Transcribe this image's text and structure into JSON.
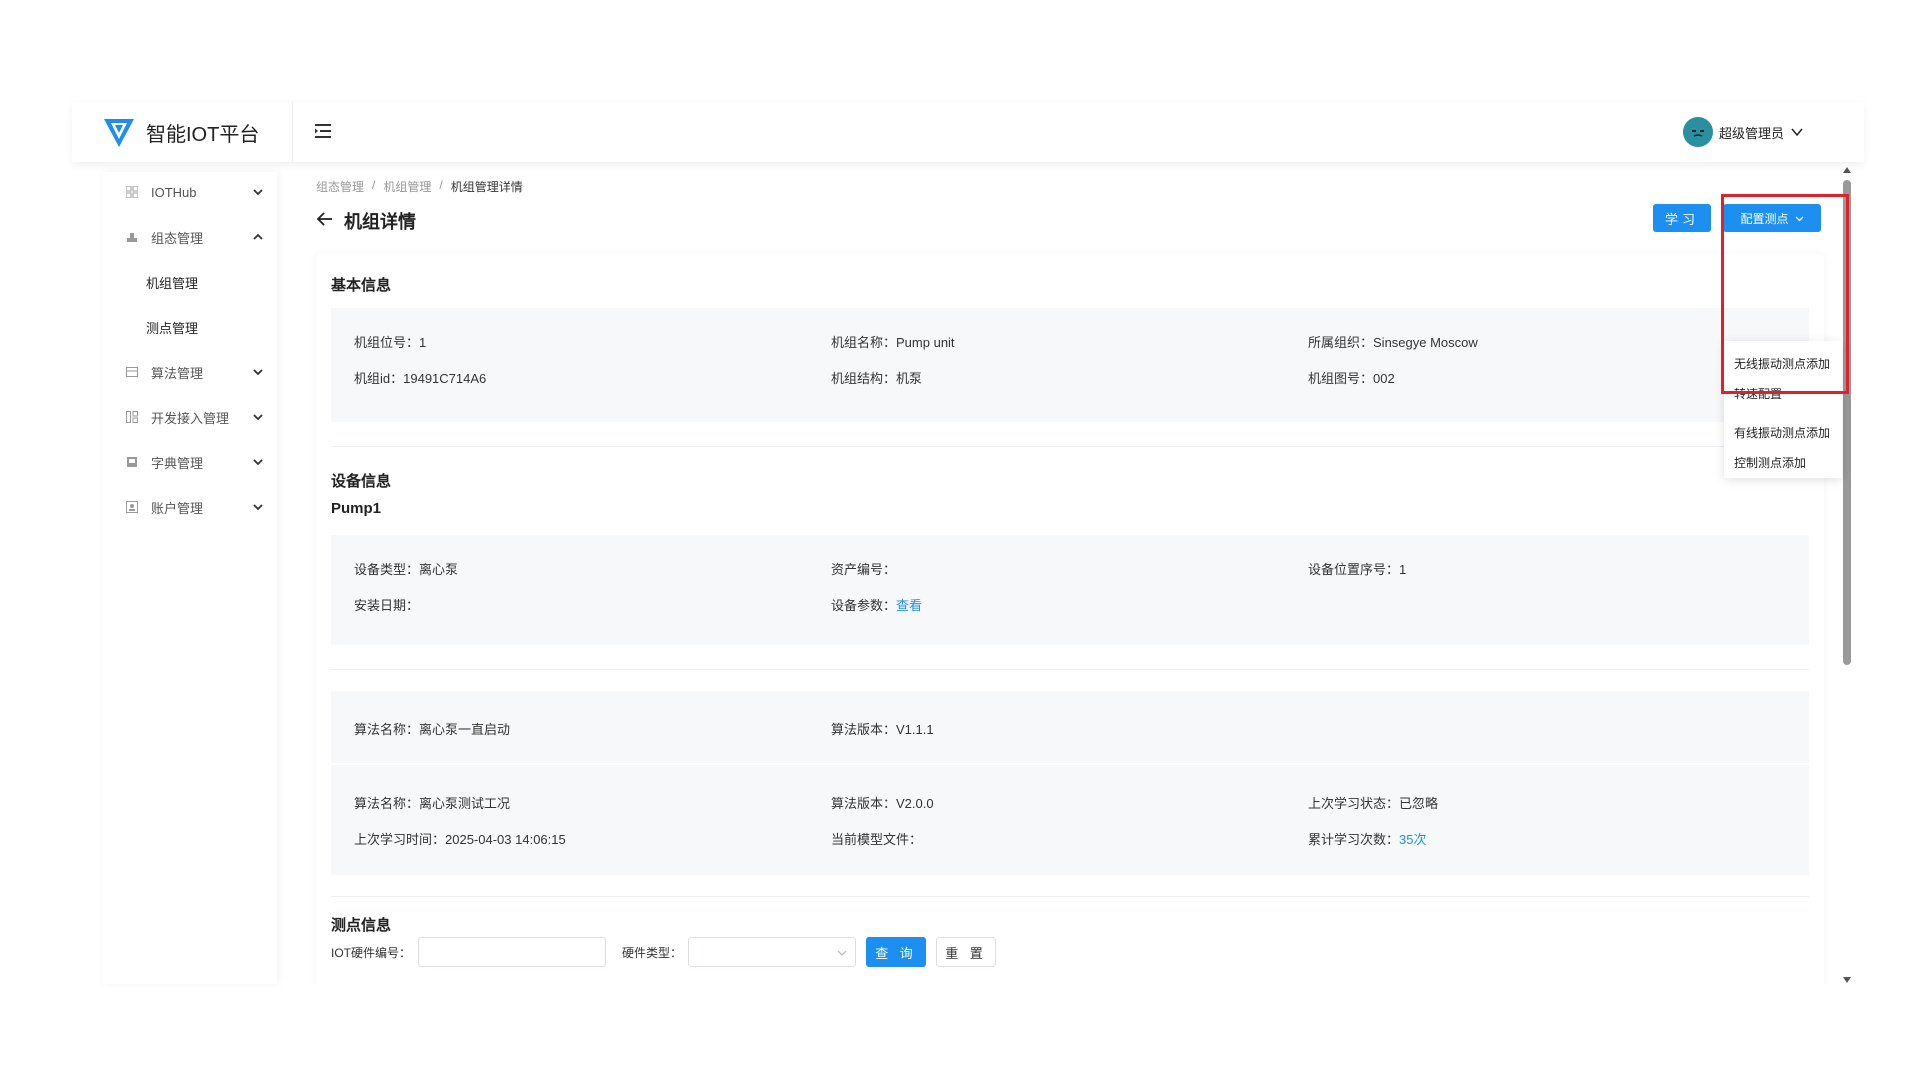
{
  "app": {
    "title": "智能IOT平台"
  },
  "header": {
    "user_name": "超级管理员"
  },
  "sidebar": {
    "items": [
      {
        "label": "IOTHub",
        "icon": "grid-icon",
        "expanded": false
      },
      {
        "label": "组态管理",
        "icon": "chart-icon",
        "expanded": true
      },
      {
        "label": "算法管理",
        "icon": "table-icon",
        "expanded": false
      },
      {
        "label": "开发接入管理",
        "icon": "dev-icon",
        "expanded": false
      },
      {
        "label": "字典管理",
        "icon": "dict-icon",
        "expanded": false
      },
      {
        "label": "账户管理",
        "icon": "account-icon",
        "expanded": false
      }
    ],
    "sub_items": [
      {
        "label": "机组管理"
      },
      {
        "label": "测点管理"
      }
    ]
  },
  "breadcrumb": [
    "组态管理",
    "机组管理",
    "机组管理详情"
  ],
  "page": {
    "title": "机组详情",
    "learn_button": "学习",
    "config_button": "配置测点"
  },
  "dropdown": {
    "items": [
      "无线振动测点添加",
      "转速配置",
      "有线振动测点添加",
      "控制测点添加"
    ]
  },
  "basic_info": {
    "title": "基本信息",
    "fields": [
      {
        "key": "机组位号：",
        "value": "1"
      },
      {
        "key": "机组名称：",
        "value": "Pump unit"
      },
      {
        "key": "所属组织：",
        "value": "Sinsegye Moscow"
      },
      {
        "key": "机组id：",
        "value": "19491C714A6"
      },
      {
        "key": "机组结构：",
        "value": "机泵"
      },
      {
        "key": "机组图号：",
        "value": "002"
      }
    ]
  },
  "device_info": {
    "title": "设备信息",
    "name": "Pump1",
    "fields": [
      {
        "key": "设备类型：",
        "value": "离心泵"
      },
      {
        "key": "资产编号：",
        "value": ""
      },
      {
        "key": "设备位置序号：",
        "value": "1"
      },
      {
        "key": "安装日期：",
        "value": ""
      },
      {
        "key": "设备参数：",
        "value": "查看"
      }
    ]
  },
  "algorithms": [
    {
      "name_key": "算法名称：",
      "name": "离心泵一直启动",
      "version_key": "算法版本：",
      "version": "V1.1.1"
    },
    {
      "name_key": "算法名称：",
      "name": "离心泵测试工况",
      "version_key": "算法版本：",
      "version": "V2.0.0",
      "status_key": "上次学习状态：",
      "status": "已忽略",
      "time_key": "上次学习时间：",
      "time": "2025-04-03 14:06:15",
      "model_key": "当前模型文件：",
      "model": "",
      "count_key": "累计学习次数：",
      "count": "35次"
    }
  ],
  "measure_info": {
    "title": "测点信息",
    "iot_label": "IOT硬件编号：",
    "hw_label": "硬件类型：",
    "query_button": "查 询",
    "reset_button": "重 置"
  },
  "colors": {
    "primary": "#1d8ff0",
    "highlight": "#e0212b"
  }
}
